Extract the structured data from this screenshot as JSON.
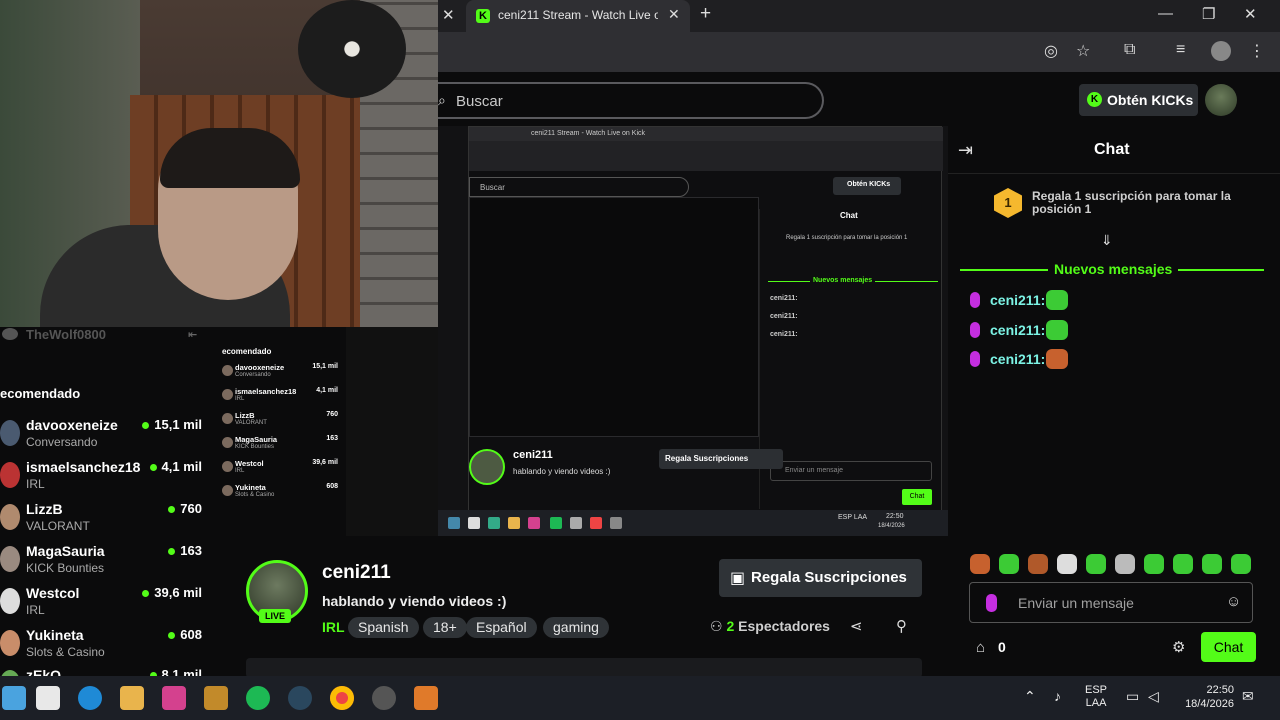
{
  "browser": {
    "tab_title": "ceni211 Stream - Watch Live on Kick",
    "tab_favicon": "K",
    "window_controls": [
      "—",
      "❐",
      "✕"
    ]
  },
  "header": {
    "search_placeholder": "Buscar",
    "kicks_label": "Obtén KICKs"
  },
  "sidebar": {
    "top_user": "TheWolf0800",
    "recommended_label": "ecomendado",
    "channels": [
      {
        "name": "davooxeneize",
        "category": "Conversando",
        "viewers": "15,1 mil"
      },
      {
        "name": "ismaelsanchez18",
        "category": "IRL",
        "viewers": "4,1 mil"
      },
      {
        "name": "LizzB",
        "category": "VALORANT",
        "viewers": "760"
      },
      {
        "name": "MagaSauria",
        "category": "KICK Bounties",
        "viewers": "163"
      },
      {
        "name": "Westcol",
        "category": "IRL",
        "viewers": "39,6 mil"
      },
      {
        "name": "Yukineta",
        "category": "Slots & Casino",
        "viewers": "608"
      },
      {
        "name": "zEkO",
        "category": "",
        "viewers": "8,1 mil"
      }
    ]
  },
  "nested": {
    "search": "Buscar",
    "kicks": "Obtén KICKs",
    "chat_title": "Chat",
    "sub_text": "Regala 1 suscripción para tomar la posición 1",
    "new_messages": "Nuevos mensajes",
    "message_user": "ceni211:",
    "input_placeholder": "Enviar un mensaje",
    "chat_button": "Chat",
    "streamer": "ceni211",
    "stream_title": "hablando y viendo videos :)",
    "gift_label": "Regala Suscripciones",
    "viewers_label": "2 Espectadores",
    "recommended": "ecomendado",
    "tags": [
      "IRL",
      "Spanish",
      "18+",
      "Español",
      "gaming"
    ],
    "time": "22:50",
    "date": "18/4/2026",
    "lang": "ESP LAA",
    "points": "0"
  },
  "chat": {
    "title": "Chat",
    "sub_rank": "1",
    "sub_text": "Regala 1 suscripción para tomar la posición 1",
    "new_messages_label": "Nuevos mensajes",
    "messages": [
      {
        "user": "ceni211:"
      },
      {
        "user": "ceni211:"
      },
      {
        "user": "ceni211:"
      }
    ],
    "input_placeholder": "Enviar un mensaje",
    "points": "0",
    "send_label": "Chat"
  },
  "stream": {
    "live_label": "LIVE",
    "streamer": "ceni211",
    "title": "hablando y viendo videos :)",
    "category": "IRL",
    "tags": [
      "Spanish",
      "18+",
      "Español",
      "gaming"
    ],
    "gift_label": "Regala Suscripciones",
    "viewer_count": "2",
    "viewer_label": "Espectadores"
  },
  "taskbar": {
    "lang_line1": "ESP",
    "lang_line2": "LAA",
    "time": "22:50",
    "date": "18/4/2026"
  },
  "colors": {
    "accent": "#53fc18",
    "background": "#0b0b0c",
    "username": "#7cf2e4",
    "mic": "#c52ee0"
  }
}
